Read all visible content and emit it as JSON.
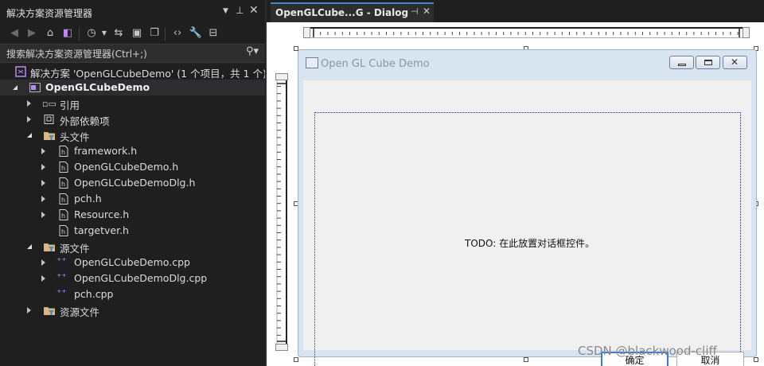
{
  "solution_explorer": {
    "title": "解决方案资源管理器",
    "search_placeholder": "搜索解决方案资源管理器(Ctrl+;)",
    "solution_label": "解决方案 'OpenGLCubeDemo' (1 个项目，共 1 个)",
    "project_label": "OpenGLCubeDemo",
    "nodes": {
      "references": "引用",
      "external_deps": "外部依赖项",
      "header_files": "头文件",
      "source_files": "源文件",
      "resource_files": "资源文件"
    },
    "headers": [
      "framework.h",
      "OpenGLCubeDemo.h",
      "OpenGLCubeDemoDlg.h",
      "pch.h",
      "Resource.h",
      "targetver.h"
    ],
    "sources": [
      "OpenGLCubeDemo.cpp",
      "OpenGLCubeDemoDlg.cpp",
      "pch.cpp"
    ]
  },
  "editor": {
    "tab_title": "OpenGLCube...G - Dialog"
  },
  "dialog": {
    "caption": "Open GL Cube Demo",
    "todo_text": "TODO: 在此放置对话框控件。",
    "ok_label": "确定",
    "cancel_label": "取消"
  },
  "watermark": "CSDN @blackwood-cliff",
  "colors": {
    "accent": "#3e86d8",
    "panel_bg": "#1f1f1f",
    "dialog_frame": "#d9e4f1"
  }
}
